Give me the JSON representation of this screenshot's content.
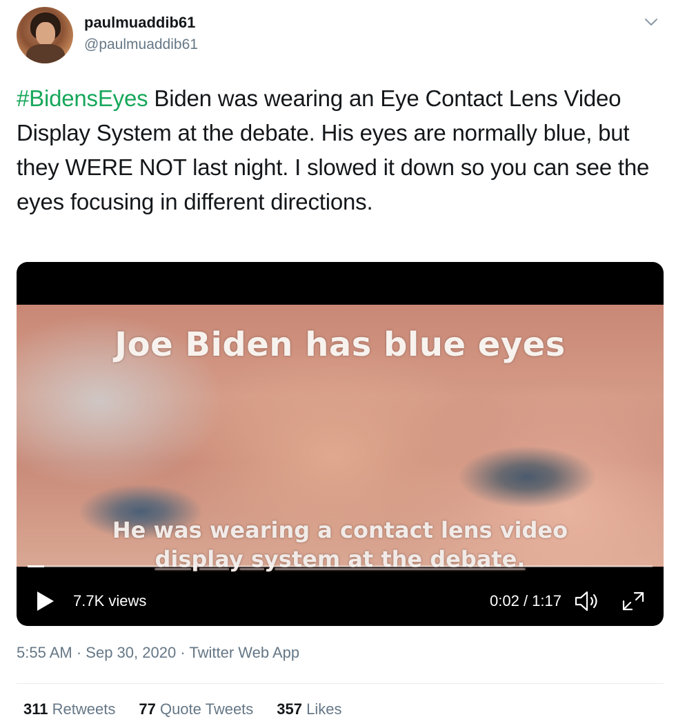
{
  "user": {
    "display_name": "paulmuaddib61",
    "handle": "@paulmuaddib61"
  },
  "tweet": {
    "hashtag": "#BidensEyes",
    "text": " Biden was wearing an Eye Contact Lens Video Display System at the debate. His eyes are normally blue, but they WERE NOT last night. I slowed it down so you can see the eyes focusing in different directions."
  },
  "video": {
    "overlay_top": "Joe Biden has blue eyes",
    "overlay_bottom_line1": "He was wearing a contact lens video",
    "overlay_bottom_line2": "display system at the debate.",
    "views": "7.7K views",
    "time": "0:02 / 1:17",
    "progress_fraction": 0.026
  },
  "meta": {
    "time": "5:55 AM",
    "date": "Sep 30, 2020",
    "source": "Twitter Web App",
    "separator": "·"
  },
  "stats": {
    "retweets_count": "311",
    "retweets_label": "Retweets",
    "quotes_count": "77",
    "quotes_label": "Quote Tweets",
    "likes_count": "357",
    "likes_label": "Likes"
  },
  "colors": {
    "hashtag": "#17a75b",
    "secondary_text": "#657786",
    "primary_text": "#14171a"
  },
  "icons": [
    "chevron-down-icon",
    "play-icon",
    "volume-icon",
    "fullscreen-icon"
  ]
}
